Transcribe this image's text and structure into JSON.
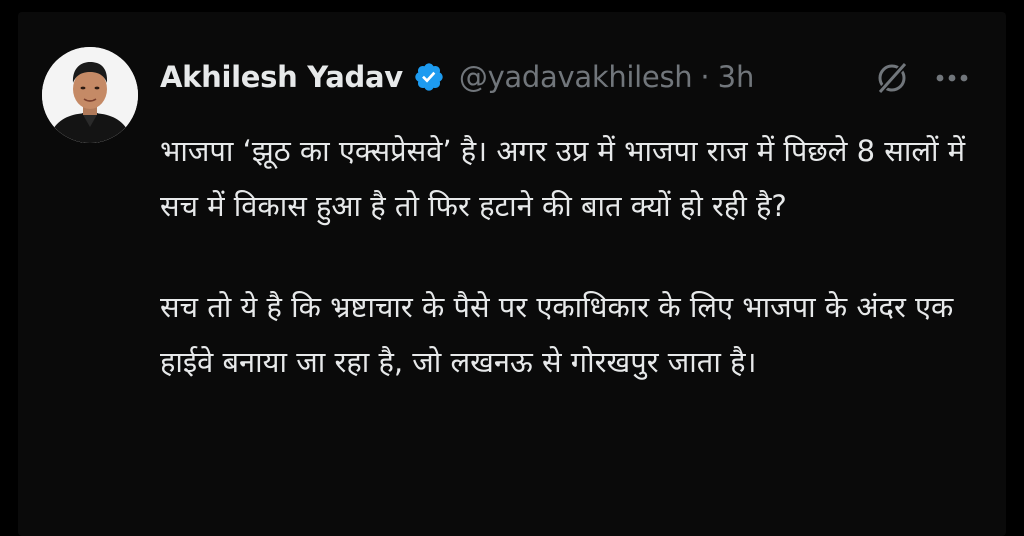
{
  "author": {
    "display_name": "Akhilesh Yadav",
    "handle": "@yadavakhilesh",
    "separator": "·",
    "timestamp": "3h",
    "verified": true
  },
  "icons": {
    "verified": "verified-badge-icon",
    "grok": "grok-icon",
    "more": "more-options-icon"
  },
  "colors": {
    "background": "#000000",
    "text_primary": "#e7e9ea",
    "text_secondary": "#71767b",
    "verified_blue": "#1d9bf0"
  },
  "tweet": {
    "paragraphs": [
      "भाजपा ‘झूठ का एक्सप्रेसवे’ है। अगर उप्र में भाजपा राज में पिछले 8 सालों में सच में विकास हुआ है तो फिर हटाने की बात क्यों हो रही है?",
      "सच तो ये है कि भ्रष्टाचार के पैसे पर एकाधिकार के लिए भाजपा के अंदर एक हाईवे बनाया जा रहा है, जो लखनऊ से गोरखपुर जाता है।"
    ]
  }
}
